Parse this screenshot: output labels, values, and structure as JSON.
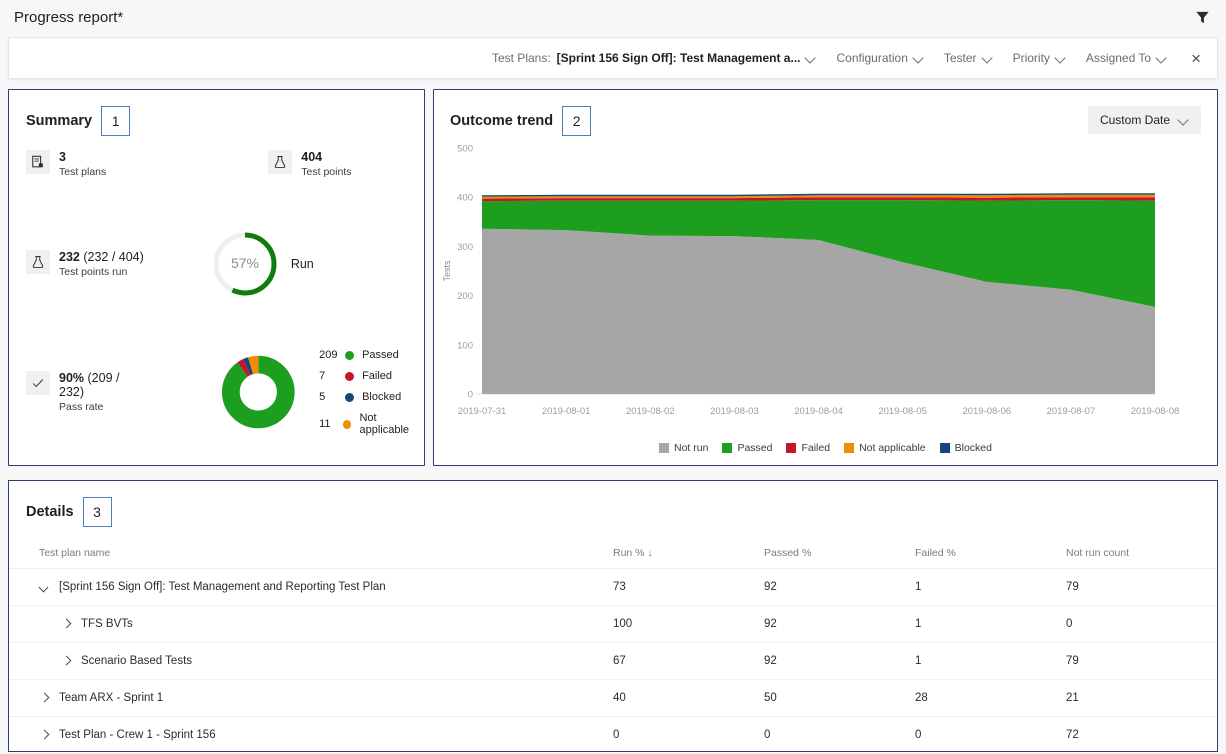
{
  "header": {
    "title": "Progress report*",
    "filter_icon": "filter-funnel-icon"
  },
  "filter_bar": {
    "test_plans_label": "Test Plans:",
    "test_plans_value": "[Sprint 156 Sign Off]: Test Management a...",
    "configuration": "Configuration",
    "tester": "Tester",
    "priority": "Priority",
    "assigned_to": "Assigned To",
    "close_label": "×"
  },
  "summary": {
    "title": "Summary",
    "badge": "1",
    "test_plans": {
      "value": "3",
      "label": "Test plans",
      "icon": "test-plan-icon"
    },
    "test_points": {
      "value": "404",
      "label": "Test points",
      "icon": "flask-icon"
    },
    "test_points_run": {
      "value": "232",
      "paren": "(232 / 404)",
      "label": "Test points run",
      "icon": "flask-icon"
    },
    "run_gauge": {
      "percent_label": "57%",
      "percent": 57,
      "label": "Run",
      "color": "#107c10"
    },
    "pass_rate": {
      "value": "90%",
      "paren": "(209 / 232)",
      "label": "Pass rate",
      "icon": "checkmark-icon"
    },
    "outcome_donut": {
      "segments": [
        {
          "count": "209",
          "label": "Passed",
          "value": 209,
          "color": "#1e9e1e"
        },
        {
          "count": "7",
          "label": "Failed",
          "value": 7,
          "color": "#c4172c"
        },
        {
          "count": "5",
          "label": "Blocked",
          "value": 5,
          "color": "#14487a"
        },
        {
          "count": "11",
          "label": "Not applicable",
          "value": 11,
          "color": "#f28c00"
        }
      ]
    }
  },
  "outcome_trend": {
    "title": "Outcome trend",
    "badge": "2",
    "date_filter": "Custom Date"
  },
  "chart_data": {
    "type": "area",
    "title": "Outcome trend",
    "xlabel": "",
    "ylabel": "Tests",
    "ylim": [
      0,
      500
    ],
    "yticks": [
      0,
      100,
      200,
      300,
      400,
      500
    ],
    "grid": false,
    "legend_position": "bottom",
    "stacked": true,
    "categories": [
      "2019-07-31",
      "2019-08-01",
      "2019-08-02",
      "2019-08-03",
      "2019-08-04",
      "2019-08-05",
      "2019-08-06",
      "2019-08-07",
      "2019-08-08"
    ],
    "series": [
      {
        "name": "Not run",
        "color": "#a6a6a6",
        "values": [
          336,
          333,
          322,
          321,
          313,
          268,
          228,
          212,
          177
        ]
      },
      {
        "name": "Passed",
        "color": "#1e9e1e",
        "values": [
          56,
          60,
          71,
          72,
          81,
          126,
          165,
          182,
          216
        ]
      },
      {
        "name": "Failed",
        "color": "#c4172c",
        "values": [
          5,
          5,
          5,
          5,
          6,
          6,
          6,
          6,
          7
        ]
      },
      {
        "name": "Not applicable",
        "color": "#f28c00",
        "values": [
          4,
          4,
          4,
          4,
          4,
          4,
          5,
          5,
          5
        ]
      },
      {
        "name": "Blocked",
        "color": "#14487a",
        "values": [
          3,
          3,
          3,
          3,
          3,
          3,
          3,
          3,
          3
        ]
      }
    ]
  },
  "details": {
    "title": "Details",
    "badge": "3",
    "columns": [
      {
        "label": "Test plan name",
        "sorted": false
      },
      {
        "label": "Run %",
        "sorted": true,
        "sort_arrow": "↓"
      },
      {
        "label": "Passed %",
        "sorted": false
      },
      {
        "label": "Failed %",
        "sorted": false
      },
      {
        "label": "Not run count",
        "sorted": false
      }
    ],
    "rows": [
      {
        "name": "[Sprint 156 Sign Off]: Test Management and Reporting Test Plan",
        "indent": 0,
        "expanded": true,
        "run_pct": "73",
        "passed_pct": "92",
        "failed_pct": "1",
        "not_run_count": "79"
      },
      {
        "name": "TFS BVTs",
        "indent": 1,
        "expanded": false,
        "run_pct": "100",
        "passed_pct": "92",
        "failed_pct": "1",
        "not_run_count": "0"
      },
      {
        "name": "Scenario Based Tests",
        "indent": 1,
        "expanded": false,
        "run_pct": "67",
        "passed_pct": "92",
        "failed_pct": "1",
        "not_run_count": "79"
      },
      {
        "name": "Team ARX - Sprint 1",
        "indent": 0,
        "expanded": false,
        "run_pct": "40",
        "passed_pct": "50",
        "failed_pct": "28",
        "not_run_count": "21"
      },
      {
        "name": "Test Plan - Crew 1 - Sprint 156",
        "indent": 0,
        "expanded": false,
        "run_pct": "0",
        "passed_pct": "0",
        "failed_pct": "0",
        "not_run_count": "72"
      }
    ]
  },
  "colors": {
    "panel_border": "#2b3f72",
    "badge_border": "#4d7fbe",
    "passed": "#1e9e1e",
    "failed": "#c4172c",
    "blocked": "#14487a",
    "not_applicable": "#f28c00",
    "not_run": "#a6a6a6"
  }
}
